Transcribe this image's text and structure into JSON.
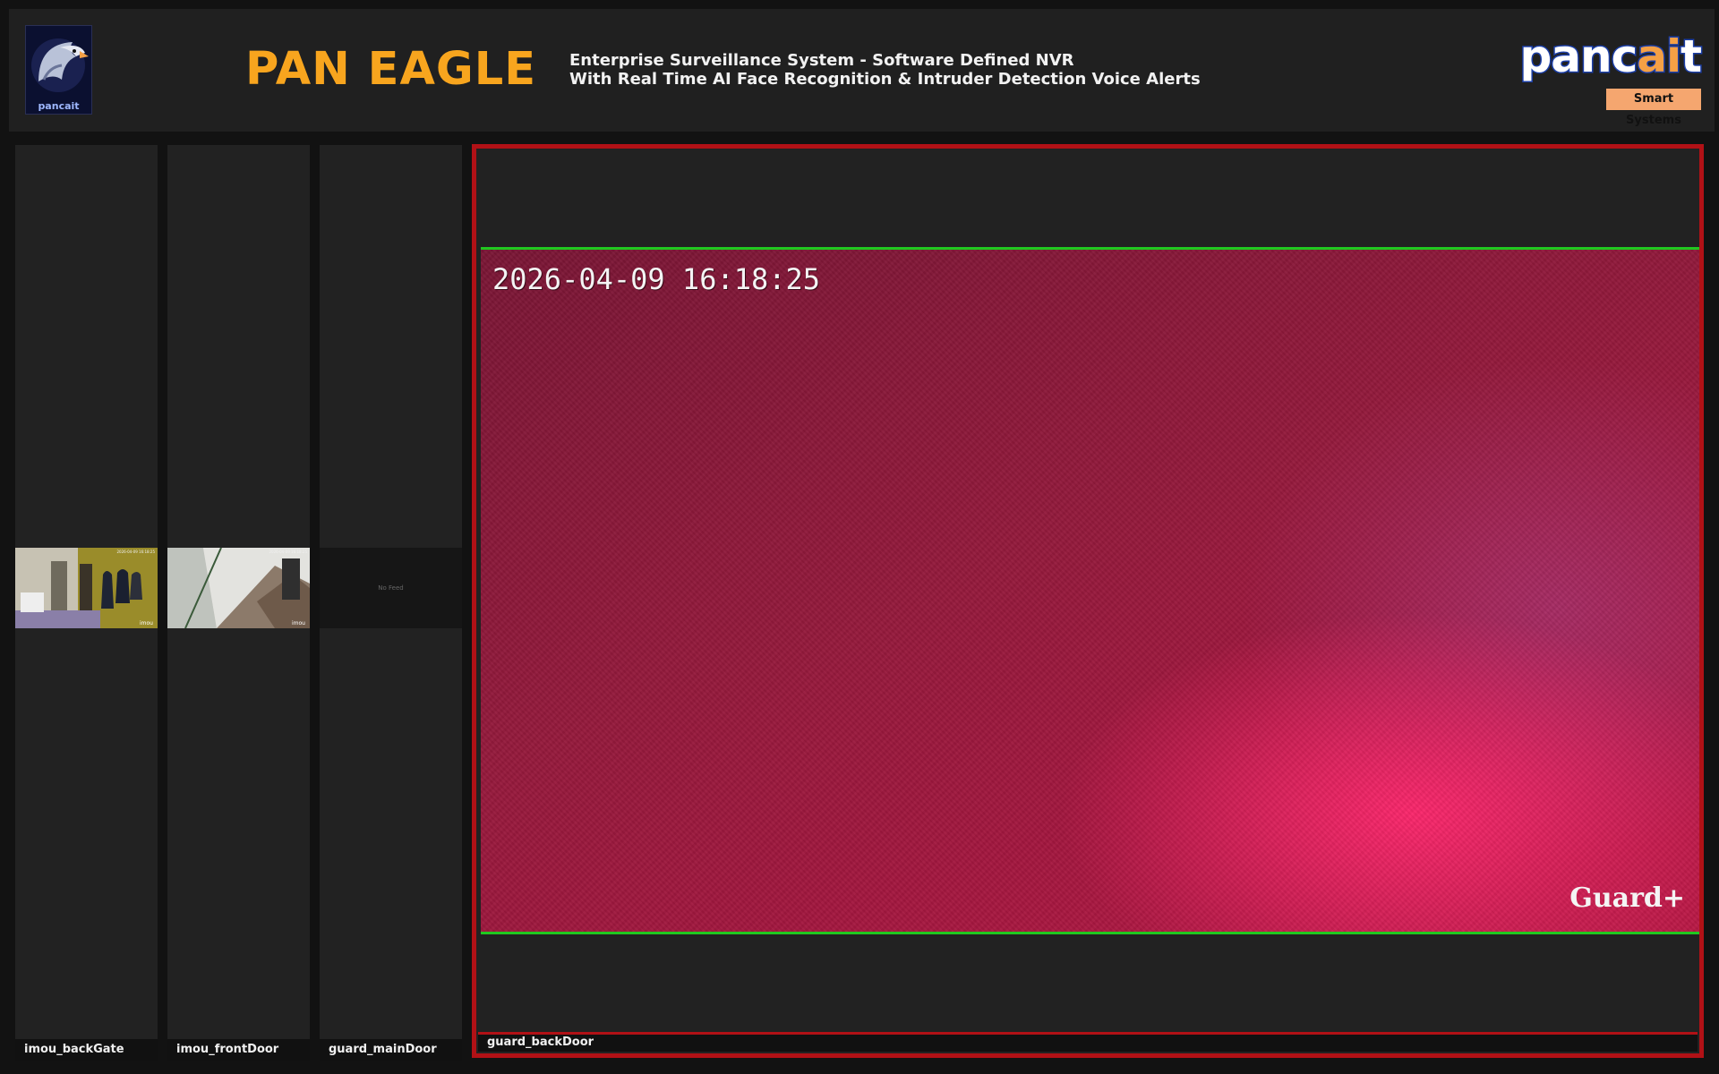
{
  "header": {
    "logo_caption": "pancait",
    "brand": "PAN EAGLE",
    "subtitle_line1": "Enterprise Surveillance System - Software Defined NVR",
    "subtitle_line2": "With Real Time AI Face Recognition & Intruder Detection Voice Alerts",
    "company_prefix": "panc",
    "company_ai": "ai",
    "company_suffix": "t",
    "company_tagline": "Smart Systems"
  },
  "cameras": [
    {
      "name": "imou_backGate",
      "status": "live"
    },
    {
      "name": "imou_frontDoor",
      "status": "live"
    },
    {
      "name": "guard_mainDoor",
      "status": "no-feed",
      "placeholder": "No Feed"
    }
  ],
  "main_view": {
    "camera_name": "guard_backDoor",
    "timestamp": "2026-04-09 16:18:25",
    "overlay_brand": "Guard+",
    "selected_border_color": "#b11116",
    "motion_line_color": "#20c820"
  },
  "colors": {
    "brand": "#f8a51e",
    "background": "#121212",
    "panel": "#222222"
  }
}
